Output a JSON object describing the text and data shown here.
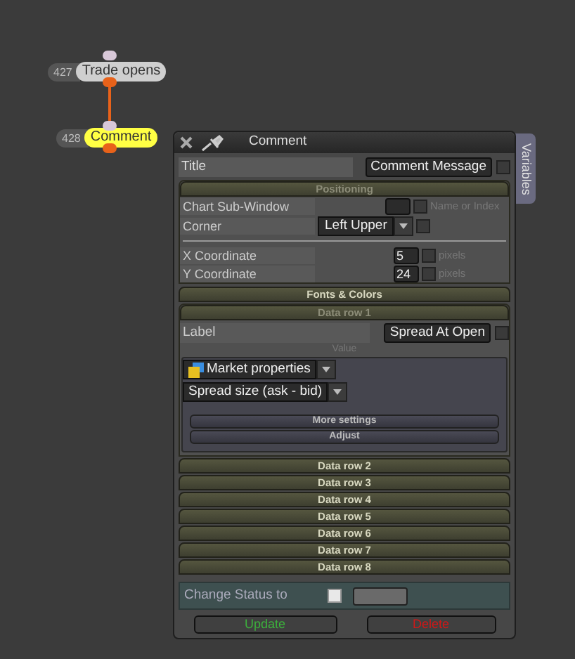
{
  "nodes": [
    {
      "number": "427",
      "label": "Trade opens",
      "selected": false
    },
    {
      "number": "428",
      "label": "Comment",
      "selected": true
    }
  ],
  "panel": {
    "title": "Comment",
    "side_tab": "Variables",
    "title_row": {
      "label": "Title",
      "value": "Comment Message",
      "checked": false
    },
    "positioning": {
      "header": "Positioning",
      "rows": [
        {
          "kind": "input",
          "label": "Chart Sub-Window",
          "value": "",
          "checked": false,
          "hint": "Name or Index"
        },
        {
          "kind": "select",
          "label": "Corner",
          "value": "Left Upper",
          "checked": false
        },
        {
          "kind": "divider"
        },
        {
          "kind": "input",
          "label": "X Coordinate",
          "value": "5",
          "checked": false,
          "hint": "pixels"
        },
        {
          "kind": "input",
          "label": "Y Coordinate",
          "value": "24",
          "checked": false,
          "hint": "pixels"
        }
      ]
    },
    "fonts_header": "Fonts & Colors",
    "data_row_1": {
      "header": "Data row 1",
      "label": "Label",
      "value": "Spread At Open",
      "checked": false,
      "value_header": "Value",
      "selects": [
        "Market properties",
        "Spread size (ask - bid)"
      ],
      "buttons": [
        "More settings",
        "Adjust"
      ]
    },
    "data_rows": [
      "Data row 2",
      "Data row 3",
      "Data row 4",
      "Data row 5",
      "Data row 6",
      "Data row 7",
      "Data row 8"
    ],
    "status": {
      "label": "Change Status to",
      "checked": false
    },
    "update": "Update",
    "delete": "Delete"
  }
}
